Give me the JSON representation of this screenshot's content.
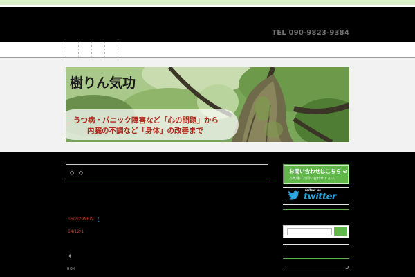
{
  "header": {
    "tel": "TEL 090-9823-9384"
  },
  "nav": {
    "item_count": 4
  },
  "banner": {
    "title": "樹りん気功",
    "line1": "うつ病・パニック障害など「心の問題」から",
    "line2": "内臓の不調など「身体」の改善まで"
  },
  "main": {
    "heading_marks": "◇ ◇",
    "news": [
      {
        "date": "16/2/29NEW",
        "link": "/ "
      },
      {
        "date": "14/12/1",
        "link": "         "
      }
    ],
    "bullet": "◆",
    "box_label": "BOX"
  },
  "sidebar": {
    "contact_main": "お問い合わせはこちら ⊙",
    "contact_sub": "お気軽にお問い合わせ下さい。",
    "twitter_followus": "follow us",
    "twitter_wordmark": "twitter",
    "search_placeholder": ""
  },
  "colors": {
    "accent_green": "#5fb848",
    "news_date_red": "#c33a2e",
    "link_blue": "#2c6ea9",
    "twitter_blue": "#2aa3df"
  }
}
